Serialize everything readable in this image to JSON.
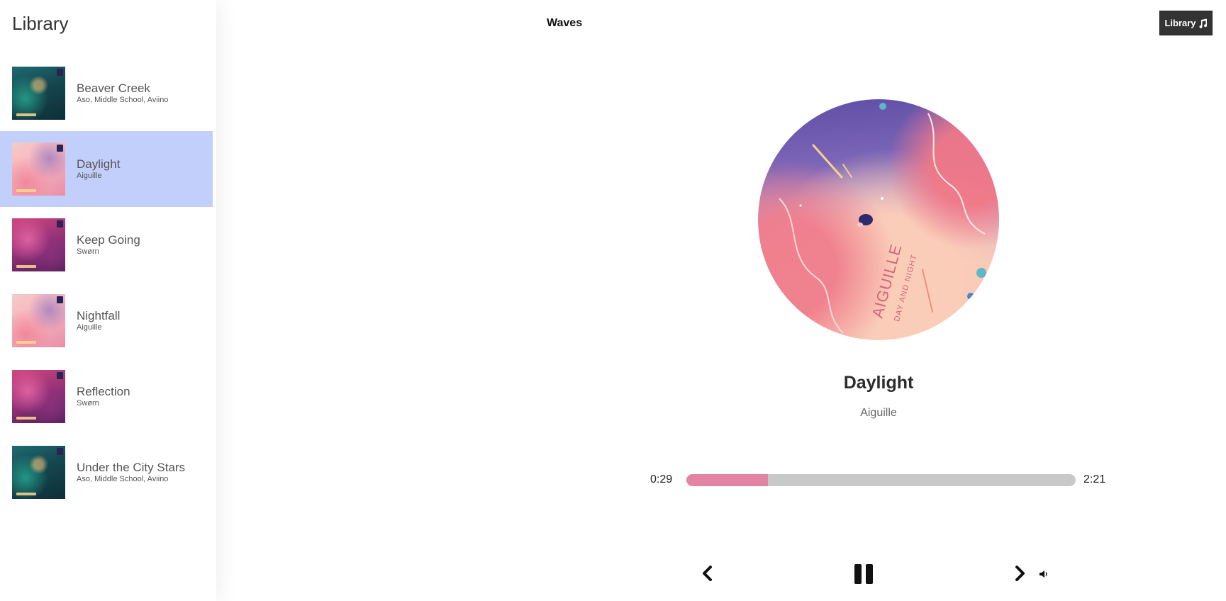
{
  "sidebar": {
    "title": "Library",
    "songs": [
      {
        "title": "Beaver Creek",
        "artist": "Aso, Middle School, Aviino",
        "cover": "cover-forest",
        "selected": false
      },
      {
        "title": "Daylight",
        "artist": "Aiguille",
        "cover": "cover-daylight",
        "selected": true
      },
      {
        "title": "Keep Going",
        "artist": "Swørn",
        "cover": "cover-purple",
        "selected": false
      },
      {
        "title": "Nightfall",
        "artist": "Aiguille",
        "cover": "cover-daylight",
        "selected": false
      },
      {
        "title": "Reflection",
        "artist": "Swørn",
        "cover": "cover-purple",
        "selected": false
      },
      {
        "title": "Under the City Stars",
        "artist": "Aso, Middle School, Aviino",
        "cover": "cover-forest",
        "selected": false
      }
    ]
  },
  "header": {
    "brand": "Waves",
    "library_button_label": "Library",
    "library_button_icon": "music-note-icon"
  },
  "player": {
    "title": "Daylight",
    "artist": "Aiguille",
    "current_time": "0:29",
    "duration": "2:21",
    "progress_fraction": 0.21,
    "album_art_text": "AIGUILLE · DAY AND NIGHT",
    "controls": {
      "prev_icon": "chevron-left-icon",
      "play_state_icon": "pause-icon",
      "next_icon": "chevron-right-icon",
      "volume_icon": "volume-icon"
    }
  },
  "colors": {
    "selected_song_bg": "#c2cffb",
    "progress_fill": "#e285a5",
    "progress_track": "#c9c9c9",
    "library_button_bg": "#333333"
  }
}
